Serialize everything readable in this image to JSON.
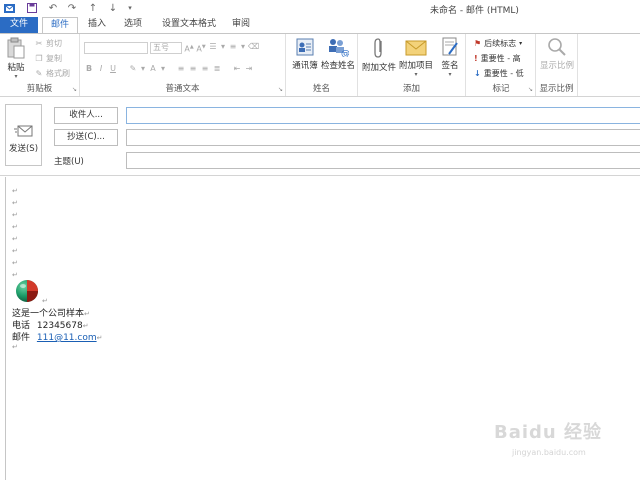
{
  "window": {
    "title": "未命名 - 邮件 (HTML)"
  },
  "qat": {
    "icons": [
      "outlook-icon",
      "save-icon",
      "undo-icon",
      "redo-icon",
      "up-icon",
      "down-icon",
      "customize-icon"
    ]
  },
  "tabs": [
    {
      "label": "文件"
    },
    {
      "label": "邮件"
    },
    {
      "label": "插入"
    },
    {
      "label": "选项"
    },
    {
      "label": "设置文本格式"
    },
    {
      "label": "审阅"
    }
  ],
  "ribbon": {
    "clipboard": {
      "label": "剪贴板",
      "paste": "粘贴",
      "cut": "剪切",
      "copy": "复制",
      "format_painter": "格式刷"
    },
    "basic_text": {
      "label": "普通文本",
      "font_size": "五号"
    },
    "names": {
      "label": "姓名",
      "address_book": "通讯簿",
      "check_names": "检查姓名"
    },
    "include": {
      "label": "添加",
      "attach_file": "附加文件",
      "attach_item": "附加项目",
      "signature": "签名"
    },
    "tags": {
      "label": "标记",
      "follow_up": "后续标志",
      "high_importance": "重要性 - 高",
      "low_importance": "重要性 - 低"
    },
    "zoom": {
      "label": "显示比例",
      "zoom": "显示比例"
    }
  },
  "header": {
    "send": "发送(S)",
    "to": "收件人...",
    "cc": "抄送(C)...",
    "subject": "主题(U)"
  },
  "body": {
    "signature_line1": "这是一个公司样本",
    "phone_label": "电话",
    "phone_value": "12345678",
    "email_label": "邮件",
    "email_value": "111@11.com"
  },
  "watermark": {
    "brand": "Baidu 经验",
    "url": "jingyan.baidu.com"
  }
}
